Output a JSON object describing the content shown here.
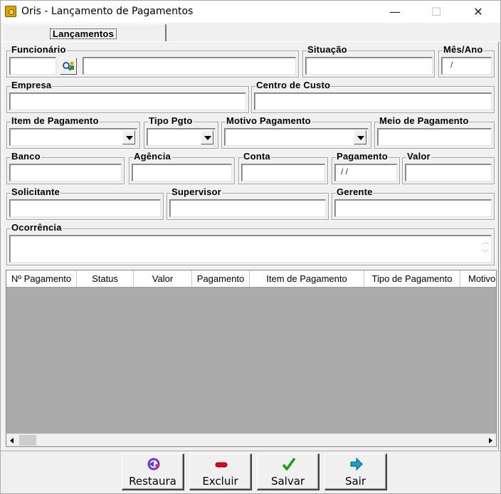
{
  "window": {
    "title": "Oris - Lançamento de Pagamentos",
    "icon": "app-icon",
    "min": "—",
    "max": "☐",
    "close": "✕"
  },
  "tab": {
    "label": "Lançamentos"
  },
  "fields": {
    "funcionario": "Funcionário",
    "situacao": "Situação",
    "mes_ano": "Mês/Ano",
    "mes_ano_value": "/",
    "empresa": "Empresa",
    "centro_custo": "Centro de Custo",
    "item_pagamento": "Item de Pagamento",
    "tipo_pgto": "Tipo Pgto",
    "motivo_pagamento": "Motivo Pagamento",
    "meio_pagamento": "Meio de Pagamento",
    "banco": "Banco",
    "agencia": "Agência",
    "conta": "Conta",
    "pagamento": "Pagamento",
    "pagamento_value": "/ /",
    "valor": "Valor",
    "solicitante": "Solicitante",
    "supervisor": "Supervisor",
    "gerente": "Gerente",
    "ocorrencia": "Ocorrência"
  },
  "grid": {
    "columns": [
      "Nº Pagamento",
      "Status",
      "Valor",
      "Pagamento",
      "Item de Pagamento",
      "Tipo de Pagamento",
      "Motivo"
    ]
  },
  "buttons": {
    "restaura": "Restaura",
    "excluir": "Excluir",
    "salvar": "Salvar",
    "sair": "Sair"
  },
  "colors": {
    "excluir_icon": "#e0001b",
    "salvar_icon": "#1a9a1a",
    "sair_icon": "#13a6c8",
    "restaura_icon": "#8a2bd1"
  }
}
